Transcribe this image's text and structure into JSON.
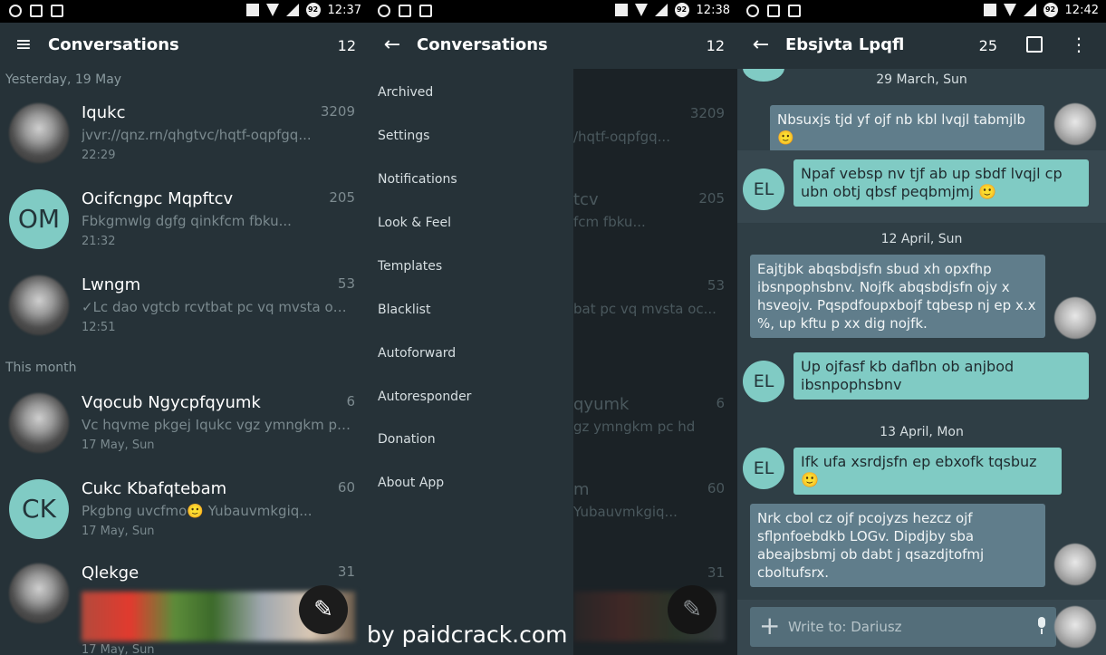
{
  "statusbars": [
    {
      "time": "12:37",
      "battery": "92"
    },
    {
      "time": "12:38",
      "battery": "92"
    },
    {
      "time": "12:42",
      "battery": "92"
    }
  ],
  "panel1": {
    "title": "Conversations",
    "count": "12",
    "sections": [
      "Yesterday, 19 May",
      "This month"
    ],
    "conversations": [
      {
        "name": "Iqukc",
        "count": "3209",
        "message": "jvvr://qnz.rn/qhgtvc/hqtf-oqpfgq...",
        "time": "22:29"
      },
      {
        "name": "Ocifcngpc Mqpftcv",
        "count": "205",
        "message": "Fbkgmwlg dgfg qinkfcm fbku...",
        "time": "21:32",
        "initials": "OM"
      },
      {
        "name": "Lwngm",
        "count": "53",
        "message": "✓Lc dao vgtcb rcvtbat pc vq mvsta oc...",
        "time": "12:51"
      },
      {
        "name": "Vqocub Ngycpfqyumk",
        "count": "6",
        "message": "Vc hqvme pkgej Iqukc vgz ymngkm pc hd",
        "time": "17 May, Sun"
      },
      {
        "name": "Cukc Kbafqtebam",
        "count": "60",
        "message": "Pkgbng uvcfmo🙂 Yubauvmkgiq...",
        "time": "17 May, Sun",
        "initials": "CK"
      },
      {
        "name": "Qlekge",
        "count": "31",
        "time": "17 May, Sun"
      }
    ],
    "icons": {
      "menu": "hamburger-icon",
      "fab": "pencil-icon"
    }
  },
  "panel2": {
    "title": "Conversations",
    "count": "12",
    "menu": [
      "Archived",
      "Settings",
      "Notifications",
      "Look & Feel",
      "Templates",
      "Blacklist",
      "Autoforward",
      "Autoresponder",
      "Donation",
      "About App"
    ],
    "ghost": {
      "count1": "3209",
      "msg1": "/hqtf-oqpfgq...",
      "name2": "tcv",
      "count2": "205",
      "msg2": "fcm fbku...",
      "count3": "53",
      "msg3": "bat pc vq mvsta oc...",
      "name4": "qyumk",
      "count4": "6",
      "msg4": "gz ymngkm pc hd",
      "name5": "m",
      "count5": "60",
      "msg5": "Yubauvmkgiq...",
      "count6": "31"
    }
  },
  "panel3": {
    "title": "Ebsjvta Lpqfl",
    "count": "25",
    "dates": [
      "29 March, Sun",
      "12 April, Sun",
      "13 April, Mon"
    ],
    "messages": [
      {
        "dir": "out",
        "text": "Nbsuxjs tjd yf ojf nb kbl lvqjl tabmjlb 🙂"
      },
      {
        "dir": "in",
        "text": "Npaf vebsp nv tjf ab up sbdf lvqjl cp ubn obtj qbsf peqbmjmj 🙂"
      },
      {
        "dir": "out",
        "text": "Eajtjbk abqsbdjsfn sbud xh opxfhp ibsnpophsbnv. Nojfk abqsbdjsfn ojy x hsveojv. Pqspdfoupxbojf tqbesp nj ep x.x %, up kftu p xx dig nojfk."
      },
      {
        "dir": "in",
        "text": "Up ojfasf kb daflbn ob anjbod ibsnpophsbnv"
      },
      {
        "dir": "in",
        "text": "Ifk ufa xsrdjsfn ep ebxofk tqsbuz 🙂"
      },
      {
        "dir": "out",
        "text": "Nrk cbol cz ojf pcojyzs hezcz ojf sflpnfoebdkb LOGv.  Dipdjby sba abeajbsbmj ob dabt j qsazdjtofmj cboltufsrx."
      }
    ],
    "contact_initials": "EL",
    "compose_placeholder": "Write to: Dariusz",
    "icons": {
      "back": "arrow-left-icon",
      "popout": "popout-icon",
      "more": "more-vert-icon",
      "add": "plus-icon",
      "mic": "microphone-icon"
    }
  },
  "watermark": "by paidcrack.com"
}
